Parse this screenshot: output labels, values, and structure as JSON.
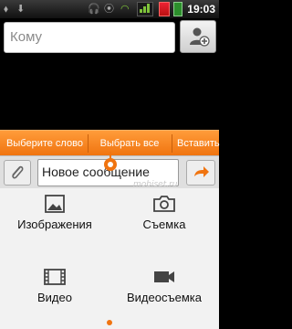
{
  "status_bar": {
    "time": "19:03"
  },
  "recipient": {
    "placeholder": "Кому"
  },
  "selection_bar": {
    "items": [
      "Выберите слово",
      "Выбрать все",
      "Вставить"
    ]
  },
  "compose": {
    "message_text": "Новое сообщение"
  },
  "attachments": {
    "images_label": "Изображения",
    "capture_label": "Съемка",
    "video_label": "Видео",
    "video_capture_label": "Видеосъемка"
  },
  "watermark": "mobiset.ru",
  "colors": {
    "accent": "#f07410",
    "panel": "#f2f2f2"
  }
}
